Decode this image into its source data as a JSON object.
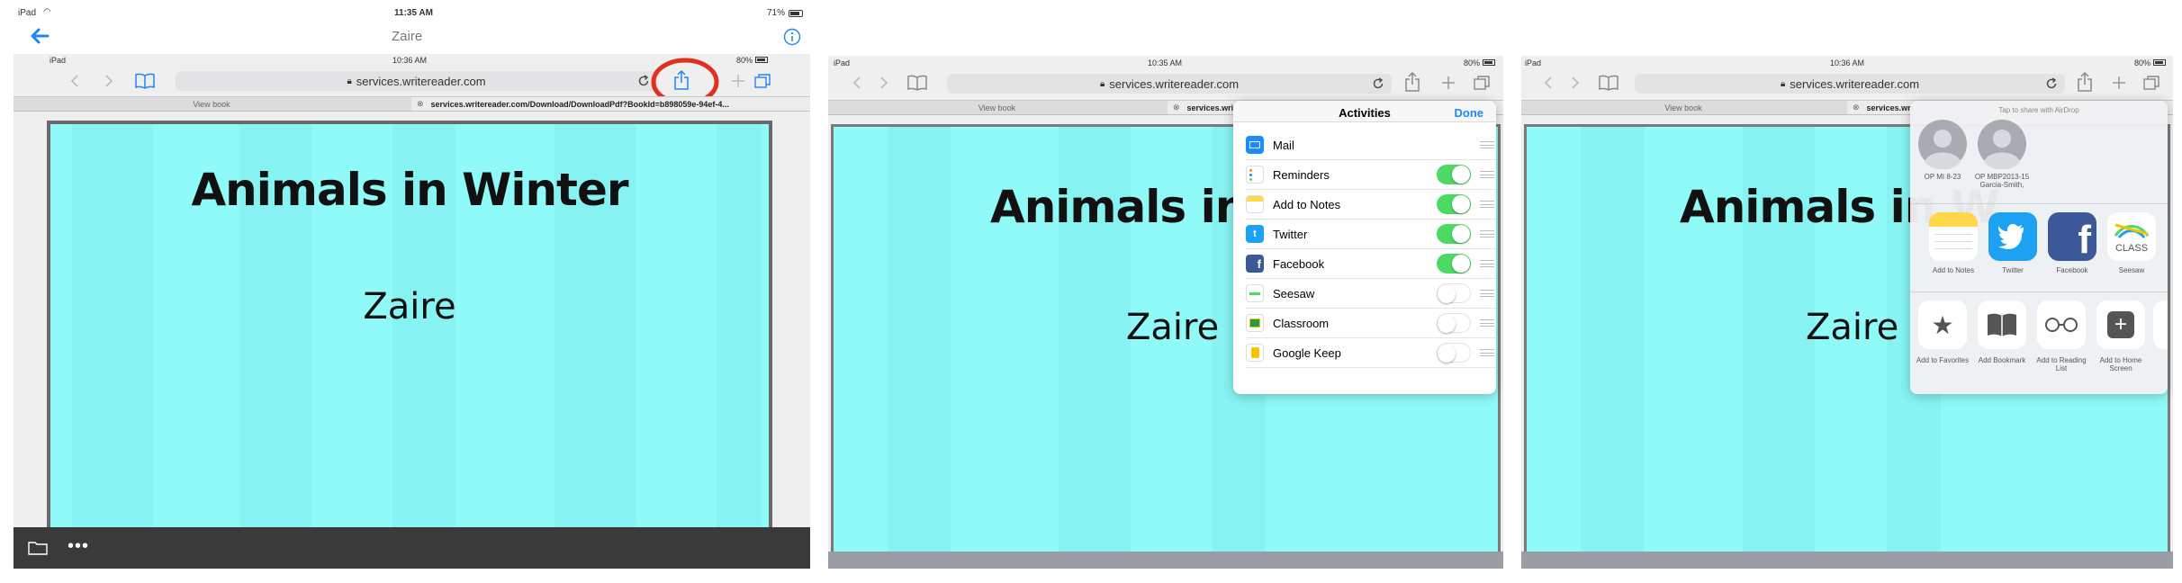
{
  "colors": {
    "accent": "#1f86f5",
    "toggle_on": "#4cd964",
    "slide_bg": "#8ffaf8",
    "highlight_circle": "#e0301e"
  },
  "panel1": {
    "status": {
      "device": "iPad",
      "time": "11:35 AM",
      "battery": "71%"
    },
    "viewer_title": "Zaire",
    "inner_status": {
      "device": "iPad",
      "time": "10:36 AM",
      "battery": "80%"
    },
    "url": "services.writereader.com",
    "tabs": {
      "first": "View book",
      "second": "services.writereader.com/Download/DownloadPdf?BookId=b898059e-94ef-4..."
    },
    "slide": {
      "title": "Animals in Winter",
      "author": "Zaire"
    }
  },
  "panel2": {
    "status": {
      "device": "iPad",
      "time": "10:35 AM",
      "battery": "80%"
    },
    "url": "services.writereader.com",
    "tabs": {
      "first": "View book",
      "second": "services.wri"
    },
    "slide": {
      "title": "Animals in W",
      "author": "Zaire"
    },
    "activities": {
      "title": "Activities",
      "done": "Done",
      "items": [
        {
          "label": "Mail",
          "icon": "mail-icon",
          "toggle": null
        },
        {
          "label": "Reminders",
          "icon": "reminders-icon",
          "toggle": true
        },
        {
          "label": "Add to Notes",
          "icon": "notes-icon",
          "toggle": true
        },
        {
          "label": "Twitter",
          "icon": "twitter-icon",
          "toggle": true
        },
        {
          "label": "Facebook",
          "icon": "facebook-icon",
          "toggle": true
        },
        {
          "label": "Seesaw",
          "icon": "seesaw-icon",
          "toggle": false
        },
        {
          "label": "Classroom",
          "icon": "classroom-icon",
          "toggle": false
        },
        {
          "label": "Google Keep",
          "icon": "google-keep-icon",
          "toggle": false
        }
      ]
    }
  },
  "panel3": {
    "status": {
      "device": "iPad",
      "time": "10:36 AM",
      "battery": "80%"
    },
    "url": "services.writereader.com",
    "tabs": {
      "first": "View book",
      "second": "services.wri"
    },
    "slide": {
      "title": "Animals in W",
      "author": "Zaire"
    },
    "share": {
      "airdrop_hint": "Tap to share with AirDrop",
      "contacts": [
        {
          "name": "OP MI 8-23"
        },
        {
          "name": "OP MBP2013-15 Garcia-Smith,"
        }
      ],
      "apps": [
        {
          "label": "Add to Notes",
          "icon": "notes-icon"
        },
        {
          "label": "Twitter",
          "icon": "twitter-icon"
        },
        {
          "label": "Facebook",
          "icon": "facebook-icon"
        },
        {
          "label": "Seesaw",
          "icon": "seesaw-icon",
          "icon_text": "CLASS"
        }
      ],
      "actions": [
        {
          "label": "Add to Favorites",
          "icon": "star-icon"
        },
        {
          "label": "Add Bookmark",
          "icon": "bookmark-icon"
        },
        {
          "label": "Add to Reading List",
          "icon": "glasses-icon"
        },
        {
          "label": "Add to Home Screen",
          "icon": "plus-square-icon"
        }
      ]
    }
  }
}
